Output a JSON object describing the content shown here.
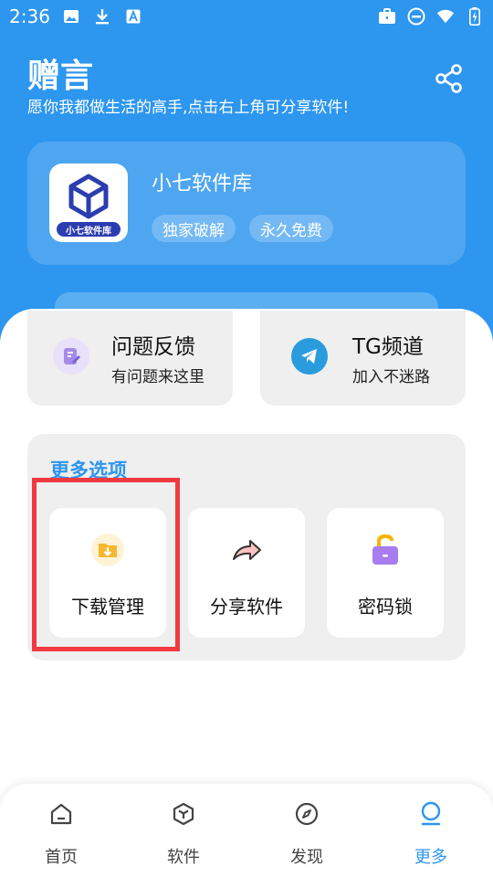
{
  "status_bar": {
    "time": "2:36",
    "left_icons": [
      "image-icon",
      "download-icon",
      "font-icon"
    ],
    "right_icons": [
      "briefcase-icon",
      "do-not-disturb-icon",
      "wifi-icon",
      "battery-charging-icon"
    ]
  },
  "header": {
    "title": "赠言",
    "subtitle": "愿你我都做生活的高手,点击右上角可分享软件!",
    "share_icon": "share-icon",
    "accent": "#2d96ef"
  },
  "app_card": {
    "icon_label": "小七软件库",
    "name": "小七软件库",
    "tags": [
      "独家破解",
      "永久免费"
    ]
  },
  "quick_cards": [
    {
      "title": "问题反馈",
      "subtitle": "有问题来这里",
      "icon": "feedback-icon"
    },
    {
      "title": "TG频道",
      "subtitle": "加入不迷路",
      "icon": "telegram-icon"
    }
  ],
  "more_options": {
    "title": "更多选项",
    "items": [
      {
        "label": "下载管理",
        "icon": "download-folder-icon"
      },
      {
        "label": "分享软件",
        "icon": "share-arrow-icon"
      },
      {
        "label": "密码锁",
        "icon": "lock-icon"
      }
    ],
    "highlight_color": "#f03a3f"
  },
  "bottom_nav": {
    "items": [
      {
        "label": "首页",
        "icon": "home-icon"
      },
      {
        "label": "软件",
        "icon": "cube-icon"
      },
      {
        "label": "发现",
        "icon": "compass-icon"
      },
      {
        "label": "更多",
        "icon": "more-icon"
      }
    ],
    "active": "更多"
  }
}
